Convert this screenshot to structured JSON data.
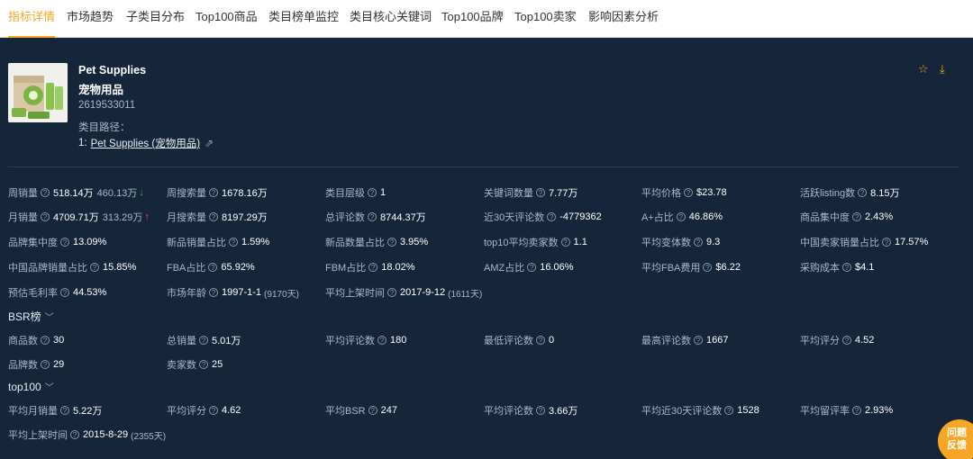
{
  "tabs": [
    {
      "label": "指标详情",
      "active": true
    },
    {
      "label": "市场趋势"
    },
    {
      "label": "子类目分布"
    },
    {
      "label": "Top100商品"
    },
    {
      "label": "类目榜单监控"
    },
    {
      "label": "类目核心关键词"
    },
    {
      "label": "Top100品牌"
    },
    {
      "label": "Top100卖家"
    },
    {
      "label": "影响因素分析"
    }
  ],
  "product": {
    "title_en": "Pet Supplies",
    "title_cn": "宠物用品",
    "id": "2619533011",
    "path_label": "类目路径：",
    "path_index": "1:",
    "path_link": "Pet Supplies (宠物用品)"
  },
  "icons": {
    "star": "star-icon",
    "download": "download-icon",
    "share": "share-icon",
    "help": "question-circle-icon"
  },
  "colors": {
    "accent": "#f5a623",
    "background": "#16263a",
    "down": "#4caf50",
    "up": "#f44336"
  },
  "metrics": {
    "weekly_sales": {
      "label": "周销量",
      "value": "518.14万",
      "sub": "460.13万",
      "trend": "down"
    },
    "weekly_search": {
      "label": "周搜索量",
      "value": "1678.16万"
    },
    "category_level": {
      "label": "类目层级",
      "value": "1"
    },
    "keyword_count": {
      "label": "关键词数量",
      "value": "7.77万"
    },
    "avg_price": {
      "label": "平均价格",
      "value": "$23.78"
    },
    "active_listing": {
      "label": "活跃listing数",
      "value": "8.15万"
    },
    "monthly_sales": {
      "label": "月销量",
      "value": "4709.71万",
      "sub": "313.29万",
      "trend": "up"
    },
    "monthly_search": {
      "label": "月搜索量",
      "value": "8197.29万"
    },
    "total_reviews": {
      "label": "总评论数",
      "value": "8744.37万"
    },
    "reviews_30d": {
      "label": "近30天评论数",
      "value": "-4779362"
    },
    "aplus_ratio": {
      "label": "A+占比",
      "value": "46.86%"
    },
    "product_concentration": {
      "label": "商品集中度",
      "value": "2.43%"
    },
    "brand_concentration": {
      "label": "品牌集中度",
      "value": "13.09%"
    },
    "new_sales_ratio": {
      "label": "新品销量占比",
      "value": "1.59%"
    },
    "new_count_ratio": {
      "label": "新品数量占比",
      "value": "3.95%"
    },
    "top10_avg_sellers": {
      "label": "top10平均卖家数",
      "value": "1.1"
    },
    "avg_variants": {
      "label": "平均变体数",
      "value": "9.3"
    },
    "cn_seller_sales_ratio": {
      "label": "中国卖家销量占比",
      "value": "17.57%"
    },
    "cn_brand_sales_ratio": {
      "label": "中国品牌销量占比",
      "value": "15.85%"
    },
    "fba_ratio": {
      "label": "FBA占比",
      "value": "65.92%"
    },
    "fbm_ratio": {
      "label": "FBM占比",
      "value": "18.02%"
    },
    "amz_ratio": {
      "label": "AMZ占比",
      "value": "16.06%"
    },
    "avg_fba_fee": {
      "label": "平均FBA费用",
      "value": "$6.22"
    },
    "purchase_cost": {
      "label": "采购成本",
      "value": "$4.1"
    },
    "est_gross_margin": {
      "label": "预估毛利率",
      "value": "44.53%"
    },
    "market_age": {
      "label": "市场年龄",
      "value": "1997-1-1",
      "extra": "(9170天)"
    },
    "avg_listing_time": {
      "label": "平均上架时间",
      "value": "2017-9-12",
      "extra": "(1611天)"
    }
  },
  "bsr": {
    "title": "BSR榜",
    "product_count": {
      "label": "商品数",
      "value": "30"
    },
    "total_sales": {
      "label": "总销量",
      "value": "5.01万"
    },
    "avg_reviews": {
      "label": "平均评论数",
      "value": "180"
    },
    "min_reviews": {
      "label": "最低评论数",
      "value": "0"
    },
    "max_reviews": {
      "label": "最高评论数",
      "value": "1667"
    },
    "avg_rating": {
      "label": "平均评分",
      "value": "4.52"
    },
    "brand_count": {
      "label": "品牌数",
      "value": "29"
    },
    "seller_count": {
      "label": "卖家数",
      "value": "25"
    }
  },
  "top100": {
    "title": "top100",
    "avg_monthly_sales": {
      "label": "平均月销量",
      "value": "5.22万"
    },
    "avg_rating": {
      "label": "平均评分",
      "value": "4.62"
    },
    "avg_bsr": {
      "label": "平均BSR",
      "value": "247"
    },
    "avg_reviews": {
      "label": "平均评论数",
      "value": "3.66万"
    },
    "avg_reviews_30d": {
      "label": "平均近30天评论数",
      "value": "1528"
    },
    "avg_review_rate": {
      "label": "平均留评率",
      "value": "2.93%"
    },
    "avg_listing_time": {
      "label": "平均上架时间",
      "value": "2015-8-29",
      "extra": "(2355天)"
    }
  },
  "feedback": {
    "line1": "问题",
    "line2": "反馈"
  }
}
